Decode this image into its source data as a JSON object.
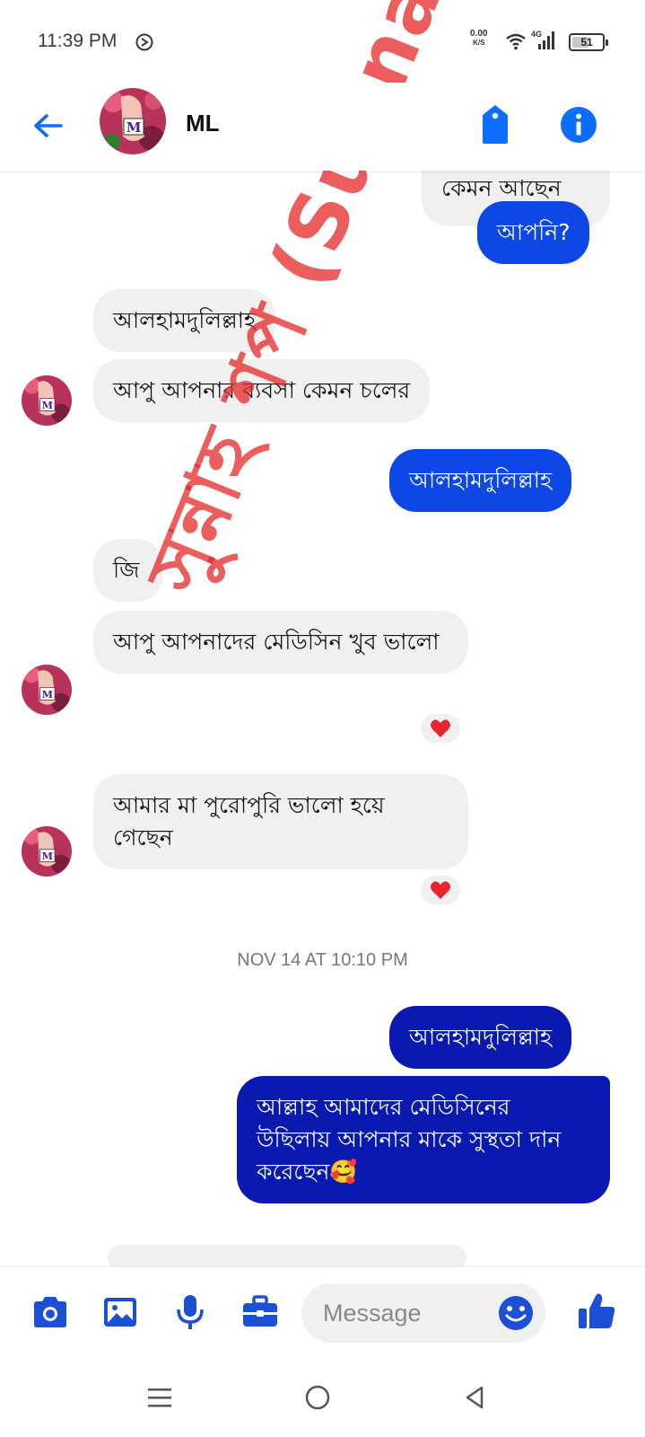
{
  "status_bar": {
    "time": "11:39 PM",
    "net_speed_value": "0.00",
    "net_speed_unit": "K/S",
    "network_type": "4G",
    "battery": "51"
  },
  "header": {
    "contact_name": "ML",
    "avatar_letter": "M"
  },
  "messages": [
    {
      "direction": "outgoing",
      "text": "কেমন আছেন"
    },
    {
      "direction": "outgoing",
      "text": "আপনি?"
    },
    {
      "direction": "incoming",
      "text": "আলহামদুলিল্লাহ"
    },
    {
      "direction": "incoming",
      "text": "আপু আপনার ব্যবসা কেমন চলের"
    },
    {
      "direction": "outgoing",
      "text": "আলহামদুলিল্লাহ"
    },
    {
      "direction": "incoming",
      "text": "জি"
    },
    {
      "direction": "incoming",
      "text": "আপু আপনাদের মেডিসিন  খুব ভালো",
      "reaction": "heart"
    },
    {
      "direction": "incoming",
      "text": "আমার মা পুরোপুরি ভালো হয়ে গেছেন",
      "reaction": "heart"
    },
    {
      "direction": "outgoing",
      "text": "আলহামদুলিল্লাহ"
    },
    {
      "direction": "outgoing",
      "text": "আল্লাহ আমাদের মেডিসিনের উছিলায় আপনার মাকে সুস্থতা দান করেছেন🥰"
    }
  ],
  "timestamp": "NOV 14 AT 10:10 PM",
  "watermark": "সুন্নাহ শপ (Sunnah shop",
  "composer": {
    "placeholder": "Message"
  },
  "colors": {
    "accent": "#0d47e6",
    "outgoing_dark": "#0a19b0",
    "incoming_bg": "#f0f0f0",
    "watermark": "#e62828"
  },
  "icons": [
    "back-arrow-icon",
    "tag-icon",
    "info-icon",
    "camera-icon",
    "image-icon",
    "microphone-icon",
    "briefcase-icon",
    "emoji-icon",
    "thumbs-up-icon",
    "heart-icon",
    "menu-icon",
    "home-circle-icon",
    "back-triangle-icon"
  ]
}
